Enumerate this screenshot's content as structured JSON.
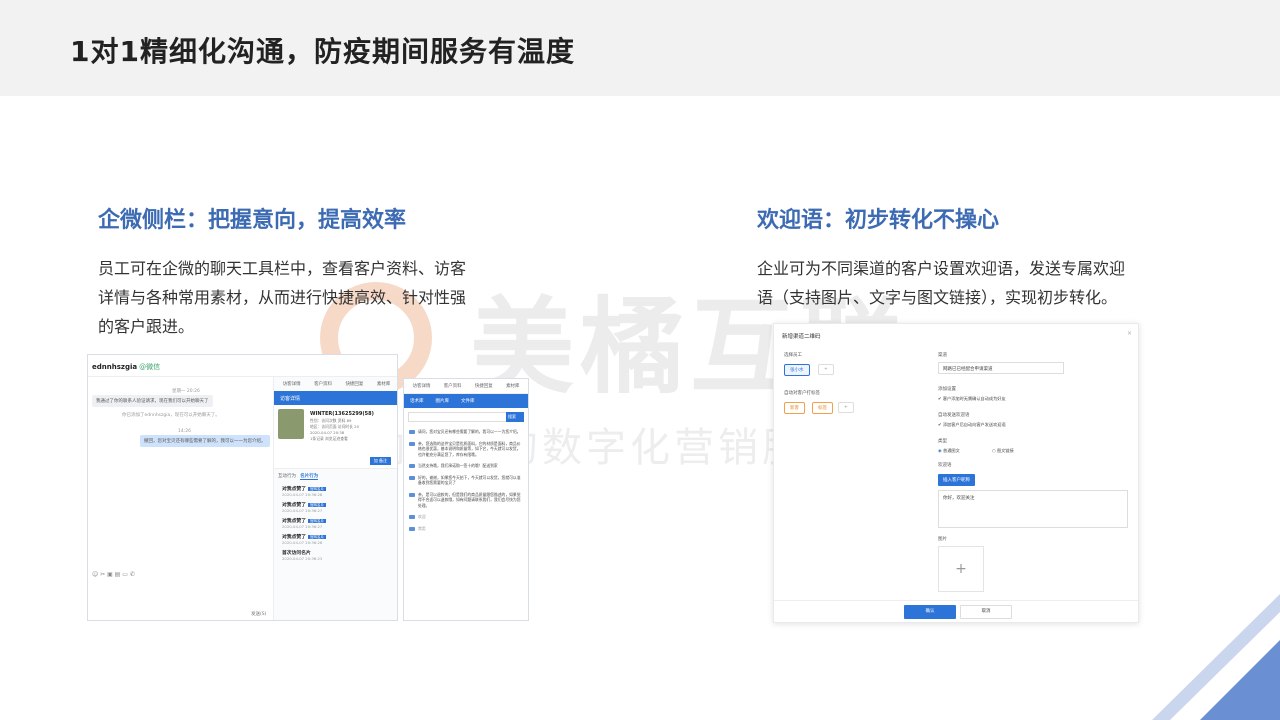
{
  "slide": {
    "title": "1对1精细化沟通，防疫期间服务有温度"
  },
  "watermark": {
    "brand": "美橘互联",
    "slogan": "国内领先的数字化营销服务商"
  },
  "left_section": {
    "title": "企微侧栏：把握意向，提高效率",
    "desc_lines": [
      "员工可在企微的聊天工具栏中，查看客户资料、访客",
      "详情与各种常用素材，从而进行快捷高效、针对性强",
      "的客户跟进。"
    ]
  },
  "right_section": {
    "title": "欢迎语：初步转化不操心",
    "desc_lines": [
      "企业可为不同渠道的客户设置欢迎语，发送专属欢迎",
      "语（支持图片、文字与图文链接），实现初步转化。"
    ]
  },
  "chat_window": {
    "contact": "ednnhszgia",
    "contact_tag": "@微信",
    "time1": "星期一 20:26",
    "msg1": "我通过了你的联系人验证请求，现在我们可以开始聊天了",
    "system1": "你已添加了ednnhszgia，现在可以开始聊天了。",
    "time2": "14:26",
    "msg2": "撤回，您对宝贝还有哪些需要了解的，我可以一一为您介绍。",
    "send_label": "发送(S)",
    "toolbar_icons": "☺ ✂ ▣ ▤ ▭ ✆",
    "side_tabs": [
      "访客详情",
      "客户资料",
      "快捷回复",
      "素材库"
    ],
    "side_header": "访客详情",
    "card_name": "WINTER(13625299(58)",
    "card_lines": [
      "性别：访问次数 资料 89",
      "地区：访问页面 访问时长 20",
      "2020-04-07 20:38"
    ],
    "card_tags": "1条记录 浏览足迹查看",
    "card_btn": "加 备注",
    "subtabs": [
      "互动行为",
      "名片行为"
    ],
    "timeline": [
      {
        "title": "对我点赞了",
        "badge": "官网名片",
        "date": "2020-04-07 20:36:28"
      },
      {
        "title": "对我点赞了",
        "badge": "官网名片",
        "date": "2020-04-07 20:36:27"
      },
      {
        "title": "对我点赞了",
        "badge": "官网名片",
        "date": "2020-04-07 20:36:27"
      },
      {
        "title": "对我点赞了",
        "badge": "官网名片",
        "date": "2020-04-07 20:36:26"
      },
      {
        "title": "首次访问名片",
        "badge": "",
        "date": "2020-04-07 20:36:23"
      }
    ]
  },
  "material_panel": {
    "tabs": [
      "访客详情",
      "客户资料",
      "快捷回复",
      "素材库"
    ],
    "sub_tabs": [
      "话术库",
      "图片库",
      "文件库"
    ],
    "search_btn": "搜索",
    "items": [
      "请问，您对宝贝还有哪些需要了解的，我可以一一为您介绍。",
      "亲，您选购的这件宝贝是优质面料，它的材质是面料，商品价格也很优惠，基本说明和质量等，如下它，今天就可以发货。也许能充分满足您了，库存有限哦。",
      "当然支持哦，我们承诺购一签十的哦！配送到家",
      "好的，谢谢，如果您今天拍下，今天就可以发货，您就可以准备收到您需要的宝贝了",
      "亲，是可以退款的，但是我们的商品质量跟您描述的，如果觉得不合适可以退款哦，如有问题请联系我们，我们会尽快为您处理。"
    ],
    "footer_items": [
      "欢迎",
      "常用"
    ]
  },
  "qr_form": {
    "title": "新增渠道二维码",
    "staff_label": "选择员工",
    "staff_chip": "张小水",
    "channel_label": "渠道",
    "channel_value": "网路已已经配合申请渠道",
    "auto_tag_label": "自动对客户打标签",
    "tags": [
      "新客",
      "标签"
    ],
    "add_setting_label": "添加设置",
    "add_setting_check": "客户添加时无需确认自动成为好友",
    "auto_invite_label": "自动发送欢迎语",
    "auto_invite_check": "添加客户后自动向客户发送欢迎语",
    "type_label": "类型",
    "type_options": [
      "普通图文",
      "图文链接"
    ],
    "welcome_label": "欢迎语",
    "insert_btn": "插入客户昵称",
    "welcome_text": "你好，欢迎关注",
    "image_label": "图片",
    "ok_btn": "确认",
    "cancel_btn": "取消"
  },
  "colors": {
    "accent_blue": "#3d6bb3",
    "ui_blue": "#2d74d8",
    "deco_blue": "#6a90d3"
  }
}
